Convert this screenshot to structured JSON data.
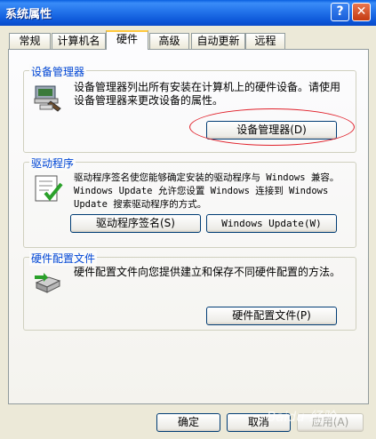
{
  "window": {
    "title": "系统属性",
    "help_label": "?",
    "close_label": "✕"
  },
  "tabs": [
    {
      "label": "常规"
    },
    {
      "label": "计算机名"
    },
    {
      "label": "硬件",
      "active": true
    },
    {
      "label": "高级"
    },
    {
      "label": "自动更新"
    },
    {
      "label": "远程"
    }
  ],
  "device_manager": {
    "title": "设备管理器",
    "description": "设备管理器列出所有安装在计算机上的硬件设备。请使用设备管理器来更改设备的属性。",
    "button": "设备管理器(D)",
    "icon": "device-manager-icon"
  },
  "drivers": {
    "title": "驱动程序",
    "description": "驱动程序签名使您能够确定安装的驱动程序与 Windows 兼容。Windows Update 允许您设置 Windows 连接到 Windows Update 搜索驱动程序的方式。",
    "signing_button": "驱动程序签名(S)",
    "update_button": "Windows Update(W)",
    "icon": "driver-checklist-icon"
  },
  "hw_profiles": {
    "title": "硬件配置文件",
    "description": "硬件配置文件向您提供建立和保存不同硬件配置的方法。",
    "button": "硬件配置文件(P)",
    "icon": "hardware-profiles-icon"
  },
  "footer": {
    "ok": "确定",
    "cancel": "取消",
    "apply": "应用(A)"
  },
  "watermark": "Baidu 经验",
  "colors": {
    "titlebar": "#0a5fe0",
    "group_title": "#0046d5",
    "highlight_ellipse": "#e0202a"
  }
}
